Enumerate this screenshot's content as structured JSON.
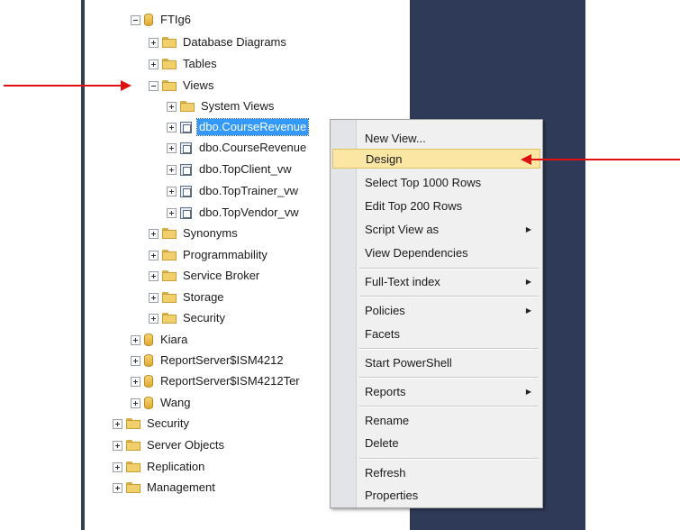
{
  "tree": {
    "database": "FTIg6",
    "folders": {
      "database_diagrams": "Database Diagrams",
      "tables": "Tables",
      "views": "Views",
      "system_views": "System Views",
      "synonyms": "Synonyms",
      "programmability": "Programmability",
      "service_broker": "Service Broker",
      "storage": "Storage",
      "db_security": "Security"
    },
    "views": [
      "dbo.CourseRevenue",
      "dbo.CourseRevenue",
      "dbo.TopClient_vw",
      "dbo.TopTrainer_vw",
      "dbo.TopVendor_vw"
    ],
    "other_databases": [
      "Kiara",
      "ReportServer$ISM4212",
      "ReportServer$ISM4212Ter",
      "Wang"
    ],
    "server_folders": [
      "Security",
      "Server Objects",
      "Replication",
      "Management"
    ]
  },
  "context_menu": {
    "new_view": "New View...",
    "design": "Design",
    "select_top": "Select Top 1000 Rows",
    "edit_top": "Edit Top 200 Rows",
    "script_view_as": "Script View as",
    "view_dependencies": "View Dependencies",
    "full_text_index": "Full-Text index",
    "policies": "Policies",
    "facets": "Facets",
    "start_powershell": "Start PowerShell",
    "reports": "Reports",
    "rename": "Rename",
    "delete": "Delete",
    "refresh": "Refresh",
    "properties": "Properties",
    "submenu_glyph": "▶",
    "highlighted_item": "Design"
  },
  "colors": {
    "selection": "#3399ff",
    "menu_highlight": "#fbe6a4",
    "annotation_arrow": "#e01010",
    "right_pane": "#2e3a57"
  }
}
